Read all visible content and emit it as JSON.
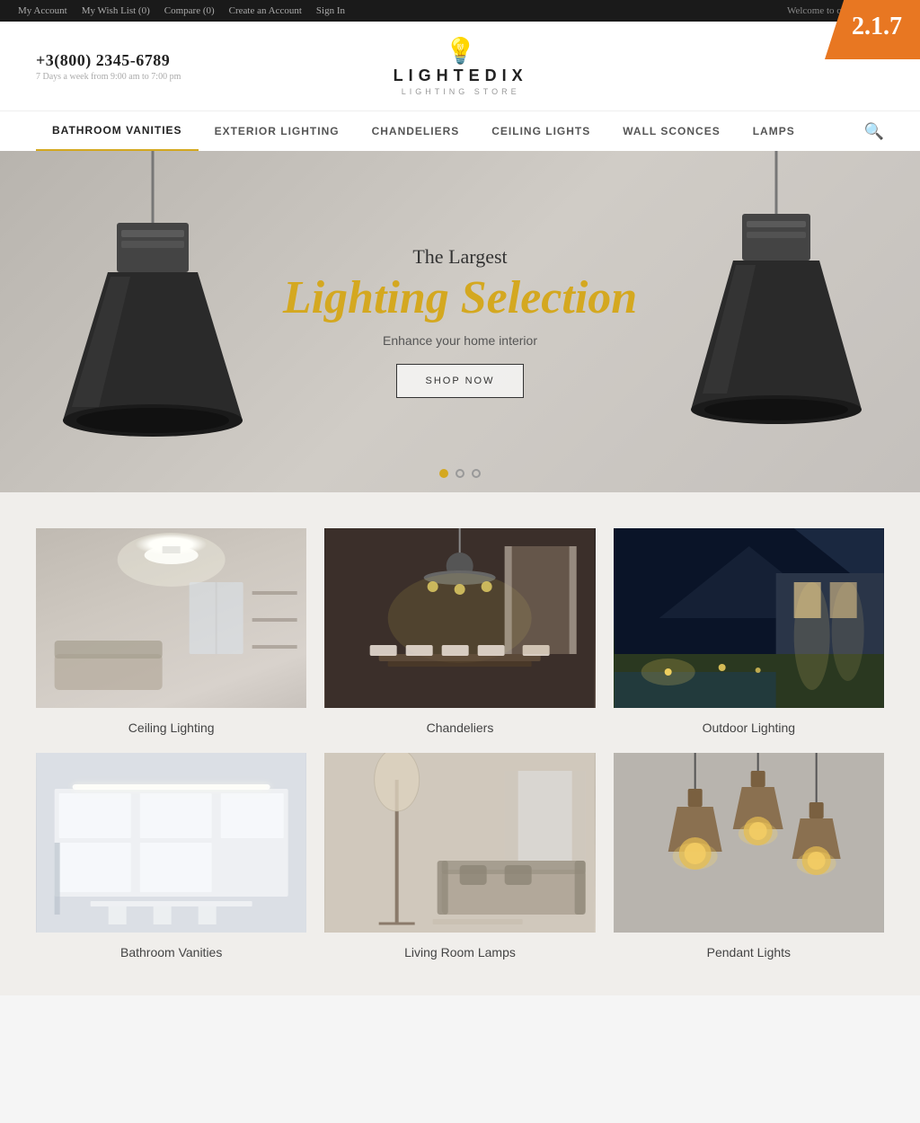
{
  "version": "2.1.7",
  "topbar": {
    "links": [
      "My Account",
      "My Wish List (0)",
      "Compare (0)",
      "Create an Account",
      "Sign In"
    ],
    "welcome": "Welcome to our online store!"
  },
  "header": {
    "phone": "+3(800) 2345-6789",
    "hours": "7 Days a week from 9:00 am to 7:00 pm",
    "logo_text": "LIGHTEDIX",
    "logo_sub": "LIGHTING  STORE"
  },
  "nav": {
    "items": [
      {
        "label": "BATHROOM VANITIES",
        "active": true
      },
      {
        "label": "EXTERIOR LIGHTING",
        "active": false
      },
      {
        "label": "CHANDELIERS",
        "active": false
      },
      {
        "label": "CEILING LIGHTS",
        "active": false
      },
      {
        "label": "WALL SCONCES",
        "active": false
      },
      {
        "label": "LAMPS",
        "active": false
      }
    ]
  },
  "hero": {
    "subtitle": "The Largest",
    "title": "Lighting Selection",
    "tagline": "Enhance your home interior",
    "cta": "SHOP NOW",
    "dots": [
      true,
      false,
      false
    ]
  },
  "categories": {
    "row1": [
      {
        "label": "Ceiling Lighting"
      },
      {
        "label": "Chandeliers"
      },
      {
        "label": "Outdoor Lighting"
      }
    ],
    "row2": [
      {
        "label": "Bathroom Vanities"
      },
      {
        "label": "Living Room Lamps"
      },
      {
        "label": "Pendant Lights"
      }
    ]
  }
}
